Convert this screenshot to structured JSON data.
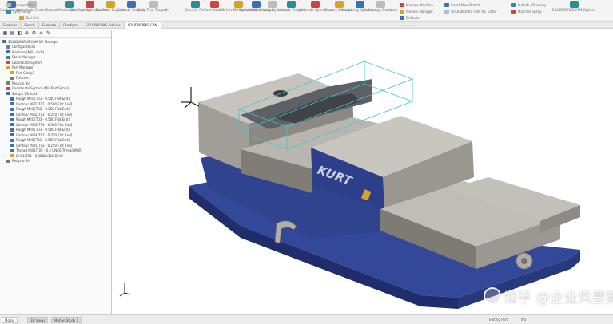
{
  "ribbon": {
    "buttons": [
      {
        "label": "Stock Manager",
        "icon": "stock-icon"
      },
      {
        "label": "Coordinate System",
        "icon": "coordinate-icon"
      },
      {
        "label": "Extract Machinable Features",
        "icon": "extract-features-icon"
      },
      {
        "label": "Generate Operation Plan",
        "icon": "operation-plan-icon"
      },
      {
        "label": "Generate Toolpath",
        "icon": "toolpath-icon"
      },
      {
        "label": "Simulate Toolpath",
        "icon": "simulate-icon"
      },
      {
        "label": "Step Thru Toolpath",
        "icon": "step-icon"
      },
      {
        "label": "Save CL File",
        "icon": "cl-file-icon"
      },
      {
        "label": "Post Process",
        "icon": "post-process-icon"
      },
      {
        "label": "2.5 Axis Mill Operations",
        "icon": "mill-ops-icon"
      },
      {
        "label": "Multisurface Features",
        "icon": "multisurface-icon"
      },
      {
        "label": "Machining Operations",
        "icon": "machining-ops-icon"
      },
      {
        "label": "Generate Toolpath",
        "icon": "gen-toolpath-icon"
      },
      {
        "label": "Generate Operation",
        "icon": "gen-op-icon"
      },
      {
        "label": "Feature Manager",
        "icon": "feature-mgr-icon"
      },
      {
        "label": "Machining Operations",
        "icon": "mach-op-icon"
      },
      {
        "label": "Technology Database",
        "icon": "tech-db-icon"
      },
      {
        "label": "SOLIDWORKS CAM Options",
        "icon": "cam-options-icon"
      }
    ],
    "rows": [
      {
        "label": "Manage Stock",
        "icon": "manage-stock-icon"
      },
      {
        "label": "Sync Setup",
        "icon": "sync-icon"
      },
      {
        "label": "Manage Machine",
        "icon": "machine-icon"
      },
      {
        "label": "Process Manager",
        "icon": "process-icon"
      },
      {
        "label": "Insert New Sketch",
        "icon": "sketch-icon"
      },
      {
        "label": "SOLIDWORKS CAM NC Editor",
        "icon": "nc-editor-icon"
      },
      {
        "label": "Publish eDrawing",
        "icon": "edrawing-icon"
      },
      {
        "label": "Machine Setup",
        "icon": "setup-icon"
      },
      {
        "label": "Tool Crib",
        "icon": "crib-icon"
      },
      {
        "label": "Defaults",
        "icon": "defaults-icon"
      }
    ]
  },
  "doc_tabs": [
    "Features",
    "Sketch",
    "Evaluate",
    "DimXpert",
    "SOLIDWORKS Add-Ins",
    "SOLIDWORKS CAM"
  ],
  "feature_manager": {
    "toolbar_icons": [
      "feature-tree-icon",
      "property-manager-icon",
      "configuration-icon",
      "dimxpert-icon",
      "cam-feature-tree-icon",
      "cam-operation-tree-icon",
      "cam-tool-tree-icon"
    ],
    "tree": [
      {
        "label": "SOLIDWORKS CAM NC Manager",
        "icon": "nc-manager-icon",
        "color": "#3d6fb3",
        "indent": 0
      },
      {
        "label": "Configurations",
        "icon": "configurations-icon",
        "color": "#7a7a7a",
        "indent": 1
      },
      {
        "label": "Machine [Mill - Inch]",
        "icon": "machine-icon",
        "color": "#3d6fb3",
        "indent": 1
      },
      {
        "label": "Stock Manager",
        "icon": "stock-icon",
        "color": "#2a8e8e",
        "indent": 1
      },
      {
        "label": "Coordinate System",
        "icon": "coordinate-system-icon",
        "color": "#c44",
        "indent": 1
      },
      {
        "label": "Part Manager",
        "icon": "part-manager-icon",
        "color": "#d8a12a",
        "indent": 1
      },
      {
        "label": "Part Setup1",
        "icon": "part-setup-icon",
        "color": "#d8a12a",
        "indent": 2
      },
      {
        "label": "Fixtures",
        "icon": "fixtures-icon",
        "color": "#7a7a7a",
        "indent": 2
      },
      {
        "label": "Recycle Bin",
        "icon": "recycle-icon",
        "color": "#7a7a7a",
        "indent": 1
      },
      {
        "label": "Coordinate System (Mill Part Setup)",
        "icon": "coordinate-icon",
        "color": "#c44",
        "indent": 1
      },
      {
        "label": "Setup1 [Group1]",
        "icon": "setup-icon",
        "color": "#3d6fb3",
        "indent": 1
      },
      {
        "label": "Rough Mill1[T01 - 0.500 Flat End]",
        "icon": "rough-mill-icon",
        "color": "#3d6fb3",
        "indent": 2
      },
      {
        "label": "Contour Mill1[T01 - 0.500 Flat End]",
        "icon": "contour-mill-icon",
        "color": "#3d6fb3",
        "indent": 2
      },
      {
        "label": "Rough Mill2[T02 - 0.250 Flat End]",
        "icon": "rough-mill-icon",
        "color": "#3d6fb3",
        "indent": 2
      },
      {
        "label": "Contour Mill2[T02 - 0.250 Flat End]",
        "icon": "contour-mill-icon",
        "color": "#3d6fb3",
        "indent": 2
      },
      {
        "label": "Rough Mill3[T03 - 0.500 Flat End]",
        "icon": "rough-mill-icon",
        "color": "#3d6fb3",
        "indent": 2
      },
      {
        "label": "Contour Mill3[T03 - 0.500 Flat End]",
        "icon": "contour-mill-icon",
        "color": "#3d6fb3",
        "indent": 2
      },
      {
        "label": "Rough Mill4[T01 - 0.500 Flat End]",
        "icon": "rough-mill-icon",
        "color": "#3d6fb3",
        "indent": 2
      },
      {
        "label": "Contour Mill4[T02 - 0.250 Flat End]",
        "icon": "contour-mill-icon",
        "color": "#3d6fb3",
        "indent": 2
      },
      {
        "label": "Rough Mill5[T01 - 0.500 Flat End]",
        "icon": "rough-mill-icon",
        "color": "#3d6fb3",
        "indent": 2
      },
      {
        "label": "Contour Mill5[T02 - 0.250 Flat End]",
        "icon": "contour-mill-icon",
        "color": "#3d6fb3",
        "indent": 2
      },
      {
        "label": "Thread Mill1[T05 - 0.5 UNC6 Thread Mill]",
        "icon": "thread-mill-icon",
        "color": "#3d6fb3",
        "indent": 2
      },
      {
        "label": "Drill1[T06 - 0.3680x118 Drill]",
        "icon": "drill-icon",
        "color": "#d8a12a",
        "indent": 2
      },
      {
        "label": "Recycle Bin",
        "icon": "recycle-icon",
        "color": "#7a7a7a",
        "indent": 1
      }
    ]
  },
  "status_bar": {
    "tabs": [
      "Model",
      "3D Views",
      "Motion Study 1"
    ],
    "active_tab": "Model",
    "right_text": [
      "Editing Part",
      "IPS"
    ]
  },
  "watermark": {
    "text": "知乎 @企业风里飘"
  },
  "colors": {
    "base_blue": "#2a3f88",
    "vise_gray": "#a5a29c",
    "toolpath_cyan": "#3fc6d0",
    "ribbon_bg": "#f4f4f4"
  }
}
